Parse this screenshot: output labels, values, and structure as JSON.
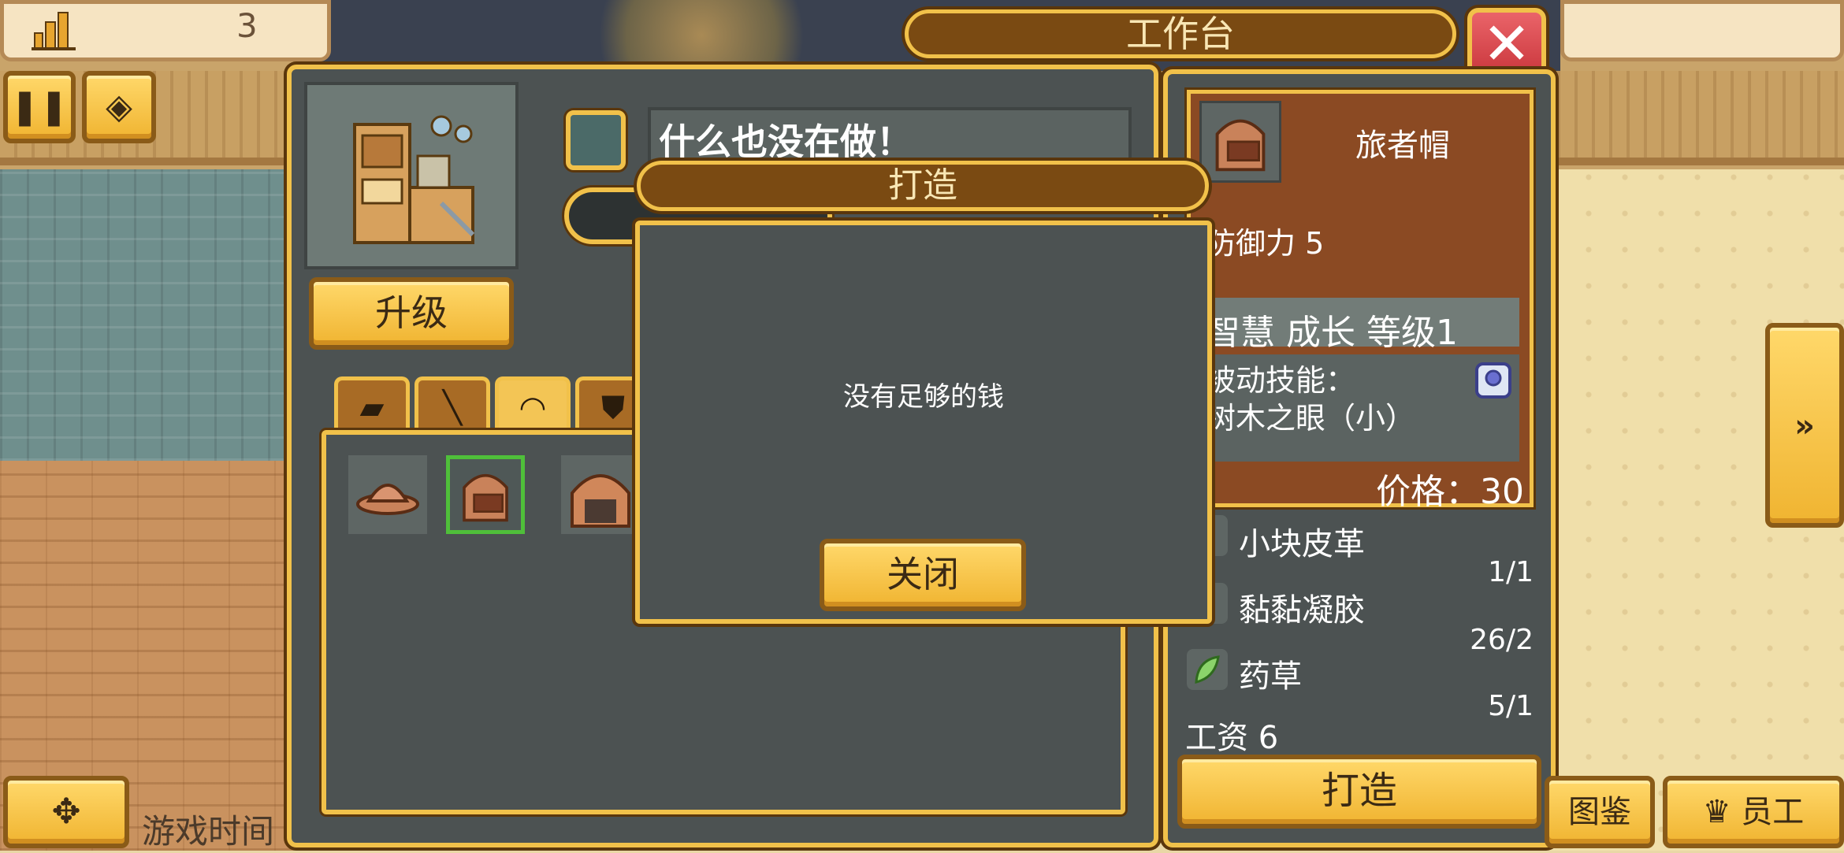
{
  "hud": {
    "building_count": "3",
    "pause_icon": "pause-icon",
    "speed_icon": "speed-icon"
  },
  "window": {
    "title": "工作台",
    "close_icon": "close-icon"
  },
  "bench": {
    "upgrade_label": "升级",
    "status_text": "什么也没在做！"
  },
  "tabs": [
    {
      "icon": "leather-icon"
    },
    {
      "icon": "staff-icon"
    },
    {
      "icon": "helmet-icon"
    },
    {
      "icon": "armor-icon"
    }
  ],
  "items": [
    {
      "icon": "cap-icon"
    },
    {
      "icon": "traveler-hat-icon"
    },
    {
      "icon": "helmet-icon"
    }
  ],
  "detail": {
    "name": "旅者帽",
    "defense": "防御力 5",
    "traits": "智慧 成长 等级1",
    "skill_label": "被动技能：",
    "skill_value": "树木之眼（小）",
    "price": "价格：30",
    "materials": [
      {
        "name": "小块皮革",
        "count": "1/1"
      },
      {
        "name": "黏黏凝胶",
        "count": "26/2"
      },
      {
        "name": "药草",
        "count": "5/1"
      }
    ],
    "wage": "工资 6",
    "craft_label": "打造"
  },
  "dialog": {
    "title": "打造",
    "message": "没有足够的钱",
    "close_label": "关闭"
  },
  "bottom": {
    "game_time": "游戏时间",
    "codex_label": "图鉴",
    "staff_label": "员工"
  },
  "colors": {
    "panel": "#4c5252",
    "gold_border": "#f1c14a",
    "button_gold": "#f0b431",
    "close_red": "#c8343a",
    "detail_brown": "#8b4a23"
  }
}
